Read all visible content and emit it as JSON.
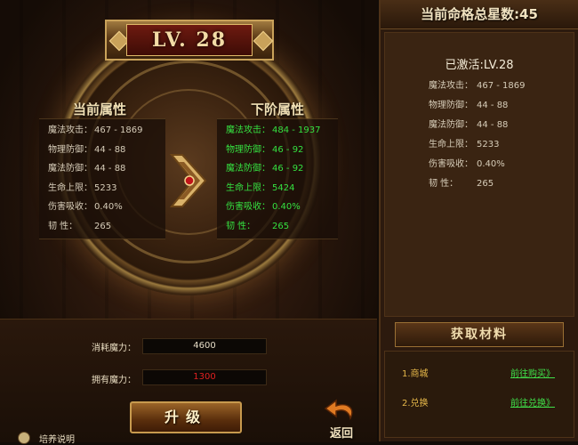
{
  "level_badge": "LV. 28",
  "current": {
    "title": "当前属性",
    "rows": [
      {
        "k": "魔法攻击：",
        "v": "467 - 1869"
      },
      {
        "k": "物理防御：",
        "v": "44 - 88"
      },
      {
        "k": "魔法防御：",
        "v": "44 - 88"
      },
      {
        "k": "生命上限：",
        "v": "5233"
      },
      {
        "k": "伤害吸收：",
        "v": "0.40%"
      },
      {
        "k": "韧    性：",
        "v": "265"
      }
    ]
  },
  "next": {
    "title": "下阶属性",
    "rows": [
      {
        "k": "魔法攻击：",
        "v": "484 - 1937"
      },
      {
        "k": "物理防御：",
        "v": "46 - 92"
      },
      {
        "k": "魔法防御：",
        "v": "46 - 92"
      },
      {
        "k": "生命上限：",
        "v": "5424"
      },
      {
        "k": "伤害吸收：",
        "v": "0.40%"
      },
      {
        "k": "韧    性：",
        "v": "265"
      }
    ]
  },
  "cost": {
    "label": "消耗魔力：",
    "value": "4600"
  },
  "own": {
    "label": "拥有魔力：",
    "value": "1300"
  },
  "upgrade_label": "升级",
  "back_label": "返回",
  "help_label": "培养说明",
  "right": {
    "title": "当前命格总星数:45",
    "activated": "已激活:LV.28",
    "rows": [
      {
        "k": "魔法攻击：",
        "v": "467 - 1869"
      },
      {
        "k": "物理防御：",
        "v": "44 - 88"
      },
      {
        "k": "魔法防御：",
        "v": "44 - 88"
      },
      {
        "k": "生命上限：",
        "v": "5233"
      },
      {
        "k": "伤害吸收：",
        "v": "0.40%"
      },
      {
        "k": "韧    性：",
        "v": "265"
      }
    ]
  },
  "materials": {
    "title": "获取材料",
    "items": [
      {
        "name": "1.商城",
        "link": "前往购买》"
      },
      {
        "name": "2.兑换",
        "link": "前往兑换》"
      }
    ]
  },
  "colors": {
    "next_stat": "#35e040",
    "own_value": "#e02020",
    "material_link": "#3fe04a",
    "material_name": "#e6b84a"
  }
}
